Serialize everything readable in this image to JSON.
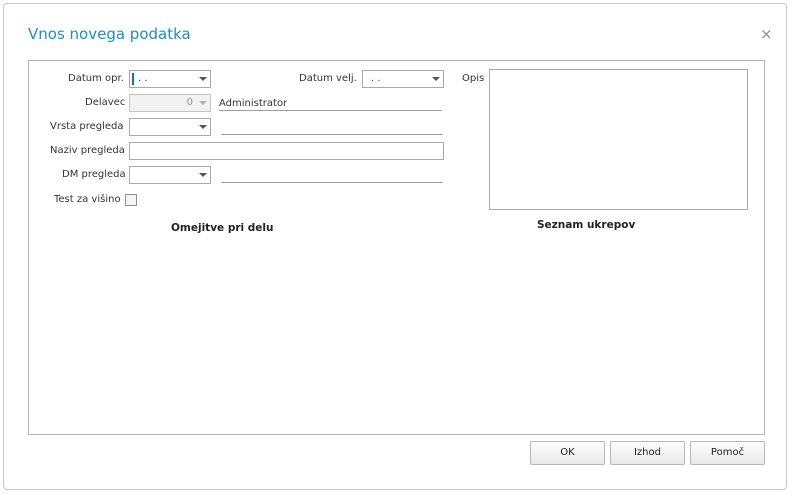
{
  "dialog": {
    "title": "Vnos novega podatka",
    "close_glyph": "×"
  },
  "form": {
    "datum_opr": {
      "label": "Datum opr.",
      "value": ". ."
    },
    "datum_velj": {
      "label": "Datum velj.",
      "value": ". ."
    },
    "delavec": {
      "label": "Delavec",
      "value": "0",
      "name": "Administrator"
    },
    "vrsta_pregleda": {
      "label": "Vrsta pregleda",
      "value": "",
      "description": ""
    },
    "naziv_pregleda": {
      "label": "Naziv pregleda",
      "value": ""
    },
    "dm_pregleda": {
      "label": "DM pregleda",
      "value": "",
      "description": ""
    },
    "test_za_visino": {
      "label": "Test za višino",
      "checked": false
    },
    "opis": {
      "label": "Opis",
      "value": ""
    }
  },
  "sections": {
    "omejitve": "Omejitve pri delu",
    "ukrepi": "Seznam ukrepov"
  },
  "buttons": {
    "ok": "OK",
    "izhod": "Izhod",
    "pomoc": "Pomoč"
  },
  "icons": {
    "close": "close-icon",
    "dropdown": "chevron-down-icon"
  }
}
